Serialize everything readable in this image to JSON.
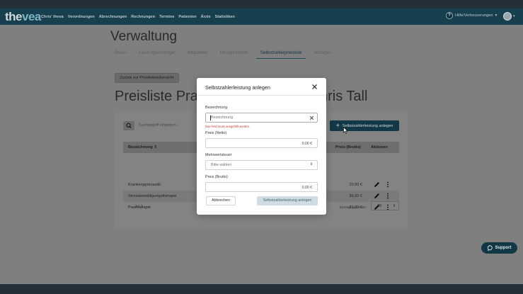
{
  "app": {
    "logo_main": "the",
    "logo_accent": "vea"
  },
  "nav": {
    "items": [
      "Chris' theva",
      "Verordnungen",
      "Abrechnungen",
      "Rechnungen",
      "Termine",
      "Patienten",
      "Ärzte",
      "Statistiken"
    ],
    "help_label": "Hilfe/Verbesserungen",
    "help_icon": "question-icon"
  },
  "page": {
    "title": "Verwaltung",
    "tabs": [
      "Praxis",
      "Leistungserbringer",
      "Mitarbeiter",
      "Privatpreisliste",
      "Selbstzahlerpreisliste",
      "Vorlagen"
    ],
    "active_tab": 4,
    "back_button": "Zurück zur Preislistenübersicht",
    "heading_left": "Preisliste Prax",
    "heading_right": "hris Tall"
  },
  "table": {
    "search_placeholder": "Suchbegriff eingeben...",
    "add_button": "Selbstzahlerleistung anlegen",
    "headers": {
      "name": "Bezeichnung ⇕",
      "price": "Preis (Brutto)",
      "actions": "Aktionen"
    },
    "rows": [
      {
        "name": "Krankengymnastik",
        "price": "10,00 €"
      },
      {
        "name": "Stressbewältigungstherapie",
        "price": "36,92 €"
      },
      {
        "name": "Paartherapie",
        "price": "31,82 €"
      }
    ],
    "pager": {
      "prev": "‹",
      "current": "1",
      "separator": "/",
      "total": "1",
      "next": "›"
    },
    "per_page_label": "Einträge pro Seite:",
    "per_page_value": "25"
  },
  "support": {
    "label": "Support"
  },
  "modal": {
    "title": "Selbstzahlerleistung anlegen",
    "name_label": "Bezeichnung",
    "name_placeholder": "Bezeichnung",
    "name_error": "Das Feld muss ausgefüllt werden.",
    "net_label": "Preis (Netto)",
    "net_value": "0,00 €",
    "vat_label": "Mehrwertsteuer",
    "vat_value": "Bitte wählen",
    "gross_label": "Preis (Brutto)",
    "gross_value": "0,00 €",
    "cancel": "Abbrechen",
    "submit": "Selbstzahlerleistung anlegen"
  }
}
